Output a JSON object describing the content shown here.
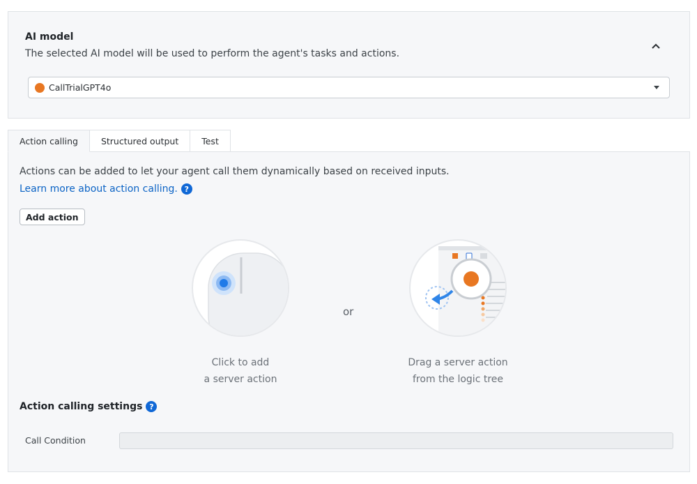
{
  "ai_model": {
    "title": "AI model",
    "description": "The selected AI model will be used to perform the agent's tasks and actions.",
    "selected_model": "CallTrialGPT4o",
    "model_color": "#e87722"
  },
  "tabs": [
    {
      "label": "Action calling",
      "active": true
    },
    {
      "label": "Structured output",
      "active": false
    },
    {
      "label": "Test",
      "active": false
    }
  ],
  "action_calling": {
    "intro": "Actions can be added to let your agent call them dynamically based on received inputs.",
    "learn_more": "Learn more about action calling.",
    "help_glyph": "?",
    "add_action_label": "Add action",
    "or_text": "or",
    "click_caption_line1": "Click to add",
    "click_caption_line2": "a server action",
    "drag_caption_line1": "Drag a server action",
    "drag_caption_line2": "from the logic tree",
    "settings_title": "Action calling settings",
    "call_condition_label": "Call Condition",
    "call_condition_value": ""
  }
}
